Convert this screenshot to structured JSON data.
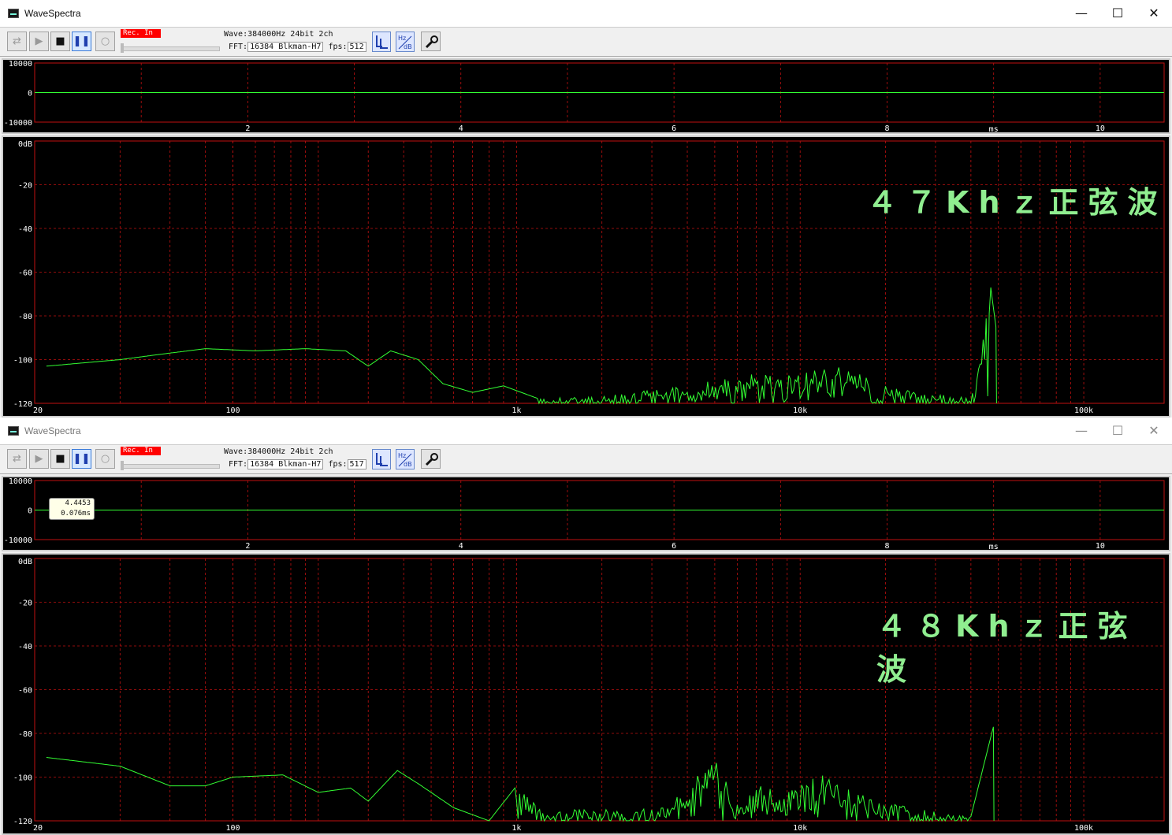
{
  "windows": [
    {
      "title": "WaveSpectra",
      "active": true,
      "rec_label": "Rec. In",
      "wave_label": "Wave:",
      "wave_value": "384000Hz 24bit 2ch",
      "fft_label": "FFT:",
      "fft_value": "16384 Blkman-H7",
      "fps_label": "fps:",
      "fps_value": "512",
      "overlay_text": "４７Khｚ正弦波",
      "spectrum_peak_hz": 47000,
      "spectrum_peak_db": -67
    },
    {
      "title": "WaveSpectra",
      "active": false,
      "rec_label": "Rec. In",
      "wave_label": "Wave:",
      "wave_value": "384000Hz 24bit 2ch",
      "fft_label": "FFT:",
      "fft_value": "16384 Blkman-H7",
      "fps_label": "fps:",
      "fps_value": "517",
      "overlay_text": "４８Khｚ正弦波",
      "tooltip_line1": "4.4453",
      "tooltip_line2": "0.076ms",
      "spectrum_peak_hz": 48000,
      "spectrum_peak_db": -77
    }
  ],
  "caption_buttons": {
    "minimize": "—",
    "maximize": "☐",
    "close": "✕"
  },
  "toolbar_icons": [
    "device-icon",
    "play-icon",
    "stop-icon",
    "pause-icon",
    "record-icon",
    "channel-lr-icon",
    "hz-db-icon",
    "settings-wrench-icon"
  ],
  "colors": {
    "trace": "#33ff33",
    "grid": "#c01010",
    "plot_bg": "#000000",
    "axis_text": "#ffffff",
    "overlay": "#90ee90"
  },
  "chart_data": [
    {
      "type": "line",
      "title": "",
      "xlabel": "ms",
      "x_ticks": [
        "2",
        "4",
        "6",
        "8",
        "10"
      ],
      "y_ticks": [
        "10000",
        "0",
        "-10000"
      ],
      "xlim": [
        0,
        10.6
      ],
      "ylim": [
        -10000,
        10000
      ],
      "series": [
        {
          "x": [
            0,
            10.6
          ],
          "y": [
            0,
            0
          ]
        }
      ]
    },
    {
      "type": "line",
      "title": "",
      "xlabel": "",
      "scale_x": "log",
      "x_ticks": [
        "20",
        "100",
        "1k",
        "10k",
        "100k"
      ],
      "y_ticks": [
        "0dB",
        "-20",
        "-40",
        "-60",
        "-80",
        "-100",
        "-120"
      ],
      "xlim": [
        20,
        192000
      ],
      "ylim": [
        -120,
        0
      ],
      "series": [
        {
          "x": [
            22,
            40,
            60,
            80,
            120,
            180,
            250,
            300,
            360,
            450,
            550,
            700,
            900,
            1200,
            1600,
            2200,
            3000,
            4000,
            5500,
            7000,
            9000,
            12000,
            15000,
            20000,
            30000,
            40000,
            47000,
            49000
          ],
          "y": [
            -103,
            -100,
            -97,
            -95,
            -96,
            -95,
            -96,
            -103,
            -96,
            -100,
            -111,
            -115,
            -112,
            -118,
            -117,
            -116,
            -114,
            -112,
            -108,
            -106,
            -107,
            -103,
            -104,
            -112,
            -116,
            -117,
            -67,
            -85
          ]
        }
      ]
    },
    {
      "type": "line",
      "title": "",
      "xlabel": "ms",
      "x_ticks": [
        "2",
        "4",
        "6",
        "8",
        "10"
      ],
      "y_ticks": [
        "10000",
        "0",
        "-10000"
      ],
      "xlim": [
        0,
        10.6
      ],
      "ylim": [
        -10000,
        10000
      ],
      "series": [
        {
          "x": [
            0,
            10.6
          ],
          "y": [
            0,
            0
          ]
        }
      ]
    },
    {
      "type": "line",
      "title": "",
      "xlabel": "",
      "scale_x": "log",
      "x_ticks": [
        "20",
        "100",
        "1k",
        "10k",
        "100k"
      ],
      "y_ticks": [
        "0dB",
        "-20",
        "-40",
        "-60",
        "-80",
        "-100",
        "-120"
      ],
      "xlim": [
        20,
        192000
      ],
      "ylim": [
        -120,
        0
      ],
      "series": [
        {
          "x": [
            22,
            40,
            60,
            80,
            100,
            150,
            200,
            260,
            300,
            380,
            450,
            600,
            800,
            1000,
            1300,
            1800,
            2500,
            3500,
            5000,
            6000,
            7000,
            9000,
            12000,
            15000,
            20000,
            30000,
            40000,
            48000
          ],
          "y": [
            -91,
            -95,
            -104,
            -104,
            -100,
            -99,
            -107,
            -105,
            -111,
            -97,
            -103,
            -114,
            -120,
            -104,
            -117,
            -112,
            -117,
            -110,
            -92,
            -108,
            -104,
            -104,
            -99,
            -106,
            -110,
            -116,
            -118,
            -77
          ]
        }
      ]
    }
  ]
}
